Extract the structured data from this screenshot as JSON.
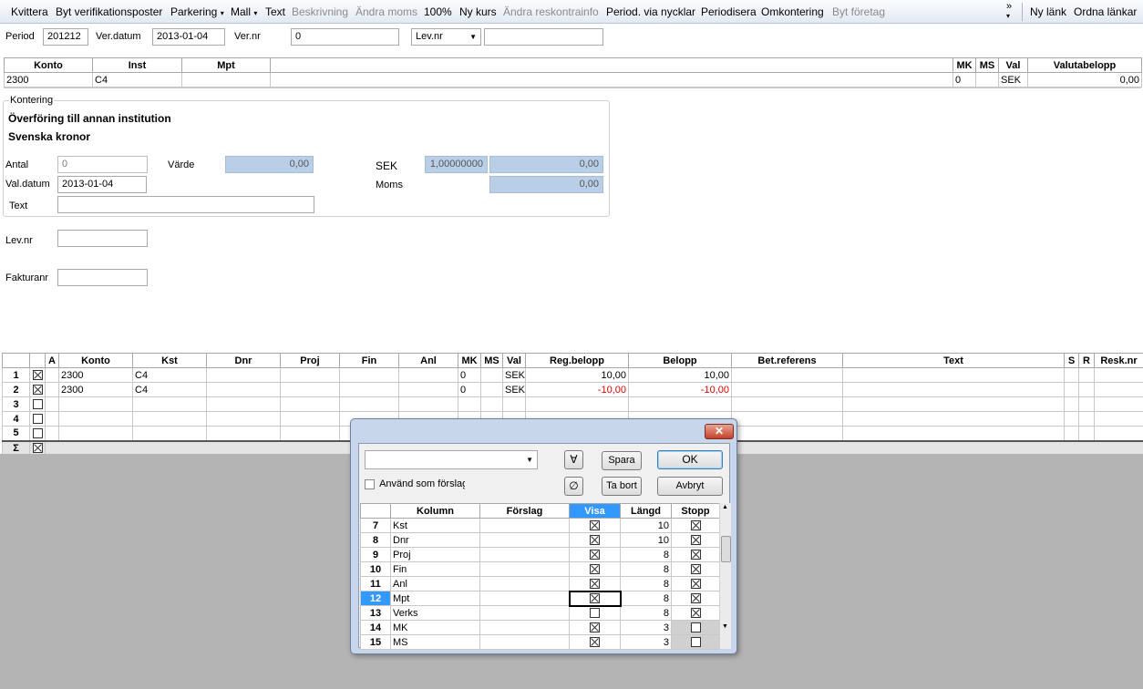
{
  "toolbar": {
    "items": [
      "Kvittera",
      "Byt verifikationsposter",
      "Parkering",
      "Mall",
      "Text",
      "Beskrivning",
      "Ändra moms",
      "100%",
      "Ny kurs",
      "Ändra reskontrainfo",
      "Period. via nycklar",
      "Periodisera",
      "Omkontering",
      "Byt företag"
    ],
    "overflow": "»",
    "links": [
      "Ny länk",
      "Ordna länkar"
    ]
  },
  "header": {
    "period_label": "Period",
    "period_value": "201212",
    "verdatum_label": "Ver.datum",
    "verdatum_value": "2013-01-04",
    "vernr_label": "Ver.nr",
    "vernr_value": "0",
    "levnr_select": "Lev.nr",
    "levnr_value": ""
  },
  "top_grid": {
    "columns": [
      "Konto",
      "Inst",
      "Mpt",
      "",
      "MK",
      "MS",
      "Val",
      "Valutabelopp"
    ],
    "row": [
      "2300",
      "C4",
      "",
      "",
      "0",
      "",
      "SEK",
      "0,00"
    ]
  },
  "kontering": {
    "legend": "Kontering",
    "title1": "Överföring till annan institution",
    "title2": "Svenska kronor",
    "antal_label": "Antal",
    "antal_value": "0",
    "varde_label": "Värde",
    "varde_value": "0,00",
    "sek_label": "SEK",
    "sek_rate": "1,00000000",
    "sek_value": "0,00",
    "moms_label": "Moms",
    "moms_value": "0,00",
    "valdatum_label": "Val.datum",
    "valdatum_value": "2013-01-04",
    "text_label": "Text",
    "text_value": ""
  },
  "lower_fields": {
    "levnr_label": "Lev.nr",
    "fakturanr_label": "Fakturanr"
  },
  "main_grid": {
    "columns": [
      "",
      "",
      "A",
      "Konto",
      "Kst",
      "Dnr",
      "Proj",
      "Fin",
      "Anl",
      "MK",
      "MS",
      "Val",
      "Reg.belopp",
      "Belopp",
      "Bet.referens",
      "Text",
      "S",
      "R",
      "Resk.nr"
    ],
    "rows": [
      {
        "n": "1",
        "checked": true,
        "konto": "2300",
        "kst": "C4",
        "mk": "0",
        "val": "SEK",
        "reg": "10,00",
        "belopp": "10,00"
      },
      {
        "n": "2",
        "checked": true,
        "konto": "2300",
        "kst": "C4",
        "mk": "0",
        "val": "SEK",
        "reg": "-10,00",
        "belopp": "-10,00"
      },
      {
        "n": "3",
        "checked": false
      },
      {
        "n": "4",
        "checked": false
      },
      {
        "n": "5",
        "checked": false
      }
    ],
    "sum_label": "Σ"
  },
  "dialog": {
    "close": "✕",
    "dropdown_value": "",
    "all_symbol": "∀",
    "none_symbol": "∅",
    "spara": "Spara",
    "ok": "OK",
    "tabort": "Ta bort",
    "avbryt": "Avbryt",
    "anvand_label": "Använd som förslag",
    "columns": [
      "",
      "Kolumn",
      "Förslag",
      "Visa",
      "Längd",
      "Stopp"
    ],
    "rows": [
      {
        "n": "7",
        "name": "Kst",
        "visa": true,
        "len": "10",
        "stopp": true
      },
      {
        "n": "8",
        "name": "Dnr",
        "visa": true,
        "len": "10",
        "stopp": true
      },
      {
        "n": "9",
        "name": "Proj",
        "visa": true,
        "len": "8",
        "stopp": true
      },
      {
        "n": "10",
        "name": "Fin",
        "visa": true,
        "len": "8",
        "stopp": true
      },
      {
        "n": "11",
        "name": "Anl",
        "visa": true,
        "len": "8",
        "stopp": true
      },
      {
        "n": "12",
        "name": "Mpt",
        "visa": true,
        "len": "8",
        "stopp": true
      },
      {
        "n": "13",
        "name": "Verks",
        "visa": false,
        "len": "8",
        "stopp": true
      },
      {
        "n": "14",
        "name": "MK",
        "visa": true,
        "len": "3",
        "stopp": false
      },
      {
        "n": "15",
        "name": "MS",
        "visa": true,
        "len": "3",
        "stopp": false
      }
    ]
  }
}
